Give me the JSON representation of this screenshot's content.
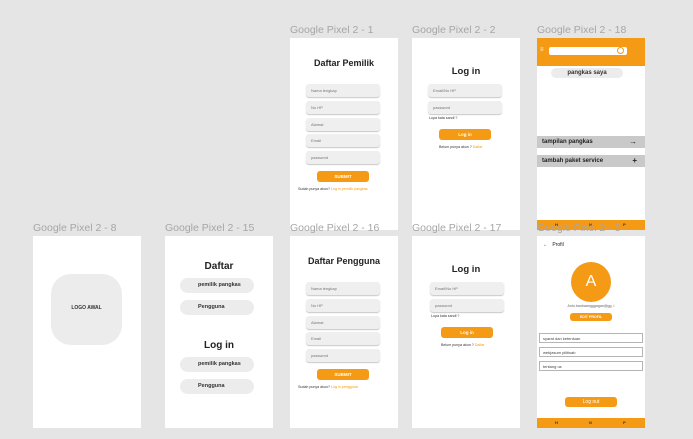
{
  "frames": {
    "f8": {
      "label": "Google Pixel 2 - 8",
      "logo": "LOGO AWAL"
    },
    "f15": {
      "label": "Google Pixel 2 - 15",
      "daftar_title": "Daftar",
      "login_title": "Log in",
      "daftar_btn1": "pemilik pangkas",
      "daftar_btn2": "Pengguna",
      "login_btn1": "pemilik pangkas",
      "login_btn2": "Pengguna"
    },
    "f1": {
      "label": "Google Pixel 2 - 1",
      "title": "Daftar Pemilik",
      "fields": [
        "Nama lengkap",
        "No HP",
        "Alamat",
        "Email",
        "password"
      ],
      "submit": "SUBMIT",
      "footer_text": "Sudah punya akun?",
      "footer_link": "Log in pemilik pangkas"
    },
    "f16": {
      "label": "Google Pixel 2 - 16",
      "title": "Daftar Pengguna",
      "fields": [
        "Nama lengkap",
        "No HP",
        "Alamat",
        "Email",
        "password"
      ],
      "submit": "SUBMIT",
      "footer_text": "Sudah punya akun?",
      "footer_link": "Log in pengguna"
    },
    "f2": {
      "label": "Google Pixel 2 - 2",
      "title": "Log in",
      "fields": [
        "Email/No HP",
        "password"
      ],
      "forgot": "Lupa kata sandi ?",
      "button": "Log in",
      "footer_text": "Belum punya akun ?",
      "footer_link": "Daftar"
    },
    "f17": {
      "label": "Google Pixel 2 - 17",
      "title": "Log in",
      "fields": [
        "Email/No HP",
        "password"
      ],
      "forgot": "Lupa kata sandi ?",
      "button": "Log in",
      "footer_text": "Belum punya akun ?",
      "footer_link": "Daftar"
    },
    "f18": {
      "label": "Google Pixel 2 - 18",
      "tab": "pangkas saya",
      "menu1": "tampilan pangkas",
      "menu2": "tambah paket service",
      "nav": [
        "H",
        "N",
        "P"
      ]
    },
    "f3": {
      "label": "Google Pixel 2 - 3",
      "back": "Profil",
      "avatar": "A",
      "email": "Anto.banbaangggagan@gg..!",
      "edit": "EDIT PROFIL",
      "items": [
        "syarat dan ketentuan",
        "webjasum pilitisab",
        "tentang us"
      ],
      "logout": "Log out",
      "nav": [
        "H",
        "N",
        "P"
      ]
    }
  },
  "colors": {
    "accent": "#f59a15",
    "background": "#e5e5e5",
    "card": "#ffffff",
    "menu": "#c9c9c9"
  }
}
